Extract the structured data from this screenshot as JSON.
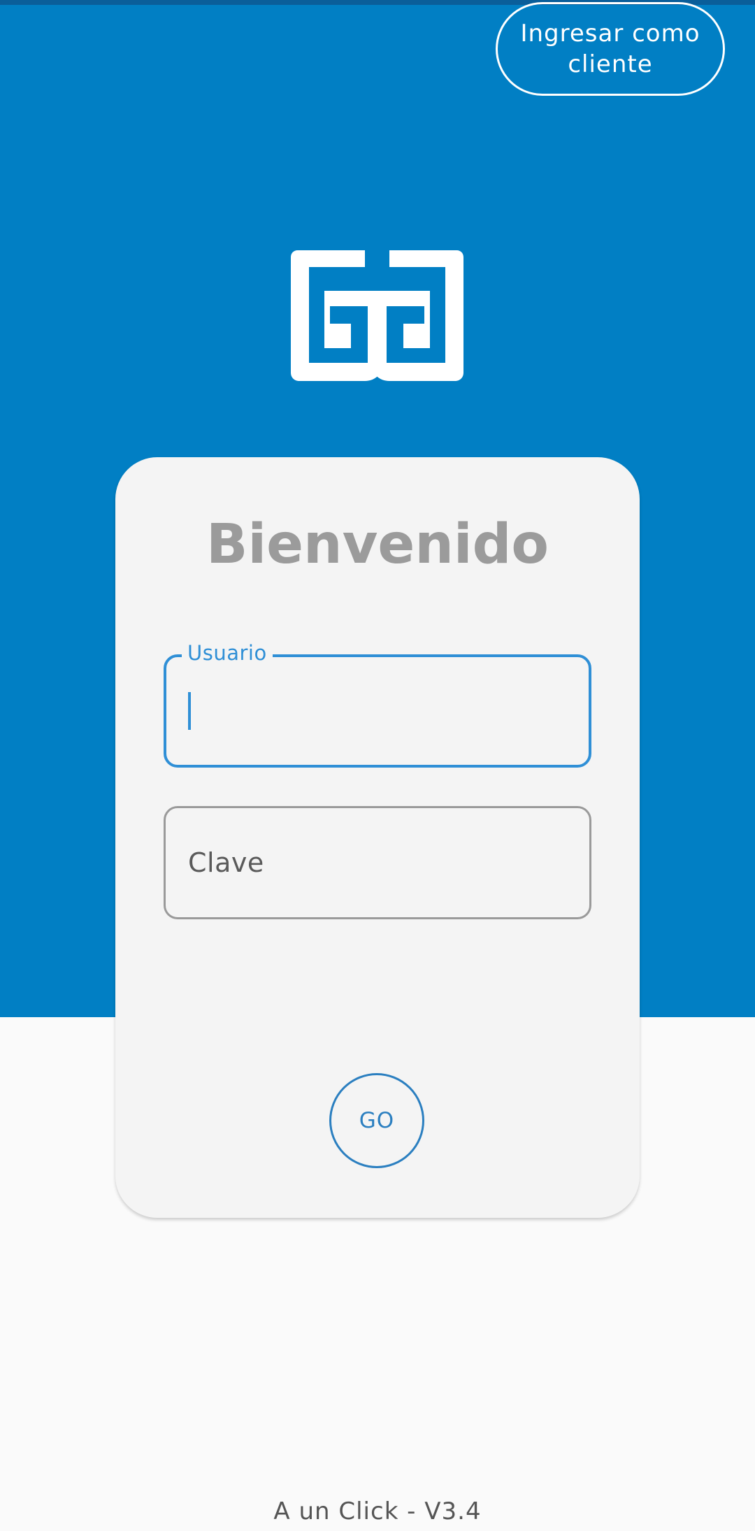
{
  "header": {
    "client_login_button": "Ingresar como cliente"
  },
  "logo": {
    "icon": "gc-brand-logo-icon",
    "color": "#ffffff"
  },
  "card": {
    "title": "Bienvenido",
    "user_field": {
      "label": "Usuario",
      "value": ""
    },
    "password_field": {
      "placeholder": "Clave",
      "value": ""
    },
    "submit_button": "GO"
  },
  "footer": {
    "version": "A un Click - V3.4"
  },
  "colors": {
    "brand_blue": "#017fc4",
    "focus_blue": "#2f8fd6",
    "card_background": "#f4f4f4",
    "page_background": "#fafafa",
    "title_gray": "#9b9b9b"
  }
}
